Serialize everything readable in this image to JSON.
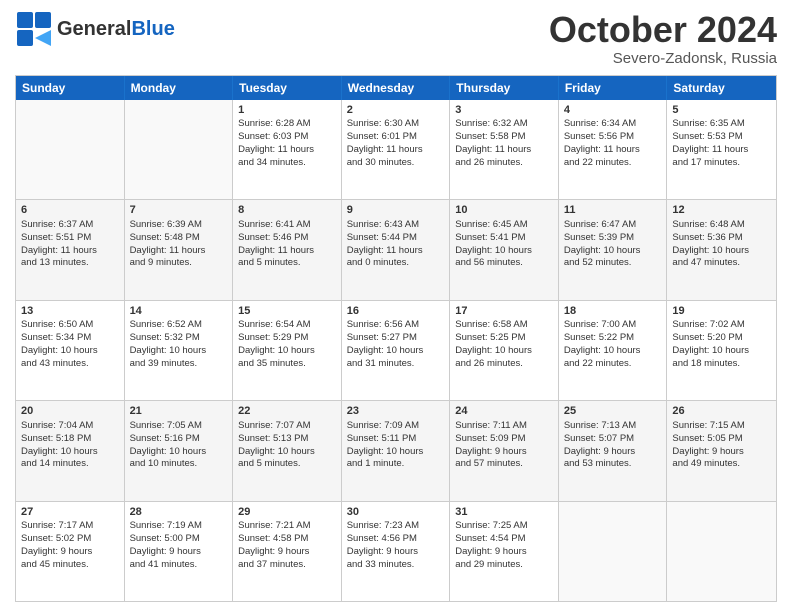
{
  "header": {
    "logo_general": "General",
    "logo_blue": "Blue",
    "month_title": "October 2024",
    "location": "Severo-Zadonsk, Russia"
  },
  "weekdays": [
    "Sunday",
    "Monday",
    "Tuesday",
    "Wednesday",
    "Thursday",
    "Friday",
    "Saturday"
  ],
  "rows": [
    [
      {
        "day": "",
        "lines": []
      },
      {
        "day": "",
        "lines": []
      },
      {
        "day": "1",
        "lines": [
          "Sunrise: 6:28 AM",
          "Sunset: 6:03 PM",
          "Daylight: 11 hours",
          "and 34 minutes."
        ]
      },
      {
        "day": "2",
        "lines": [
          "Sunrise: 6:30 AM",
          "Sunset: 6:01 PM",
          "Daylight: 11 hours",
          "and 30 minutes."
        ]
      },
      {
        "day": "3",
        "lines": [
          "Sunrise: 6:32 AM",
          "Sunset: 5:58 PM",
          "Daylight: 11 hours",
          "and 26 minutes."
        ]
      },
      {
        "day": "4",
        "lines": [
          "Sunrise: 6:34 AM",
          "Sunset: 5:56 PM",
          "Daylight: 11 hours",
          "and 22 minutes."
        ]
      },
      {
        "day": "5",
        "lines": [
          "Sunrise: 6:35 AM",
          "Sunset: 5:53 PM",
          "Daylight: 11 hours",
          "and 17 minutes."
        ]
      }
    ],
    [
      {
        "day": "6",
        "lines": [
          "Sunrise: 6:37 AM",
          "Sunset: 5:51 PM",
          "Daylight: 11 hours",
          "and 13 minutes."
        ]
      },
      {
        "day": "7",
        "lines": [
          "Sunrise: 6:39 AM",
          "Sunset: 5:48 PM",
          "Daylight: 11 hours",
          "and 9 minutes."
        ]
      },
      {
        "day": "8",
        "lines": [
          "Sunrise: 6:41 AM",
          "Sunset: 5:46 PM",
          "Daylight: 11 hours",
          "and 5 minutes."
        ]
      },
      {
        "day": "9",
        "lines": [
          "Sunrise: 6:43 AM",
          "Sunset: 5:44 PM",
          "Daylight: 11 hours",
          "and 0 minutes."
        ]
      },
      {
        "day": "10",
        "lines": [
          "Sunrise: 6:45 AM",
          "Sunset: 5:41 PM",
          "Daylight: 10 hours",
          "and 56 minutes."
        ]
      },
      {
        "day": "11",
        "lines": [
          "Sunrise: 6:47 AM",
          "Sunset: 5:39 PM",
          "Daylight: 10 hours",
          "and 52 minutes."
        ]
      },
      {
        "day": "12",
        "lines": [
          "Sunrise: 6:48 AM",
          "Sunset: 5:36 PM",
          "Daylight: 10 hours",
          "and 47 minutes."
        ]
      }
    ],
    [
      {
        "day": "13",
        "lines": [
          "Sunrise: 6:50 AM",
          "Sunset: 5:34 PM",
          "Daylight: 10 hours",
          "and 43 minutes."
        ]
      },
      {
        "day": "14",
        "lines": [
          "Sunrise: 6:52 AM",
          "Sunset: 5:32 PM",
          "Daylight: 10 hours",
          "and 39 minutes."
        ]
      },
      {
        "day": "15",
        "lines": [
          "Sunrise: 6:54 AM",
          "Sunset: 5:29 PM",
          "Daylight: 10 hours",
          "and 35 minutes."
        ]
      },
      {
        "day": "16",
        "lines": [
          "Sunrise: 6:56 AM",
          "Sunset: 5:27 PM",
          "Daylight: 10 hours",
          "and 31 minutes."
        ]
      },
      {
        "day": "17",
        "lines": [
          "Sunrise: 6:58 AM",
          "Sunset: 5:25 PM",
          "Daylight: 10 hours",
          "and 26 minutes."
        ]
      },
      {
        "day": "18",
        "lines": [
          "Sunrise: 7:00 AM",
          "Sunset: 5:22 PM",
          "Daylight: 10 hours",
          "and 22 minutes."
        ]
      },
      {
        "day": "19",
        "lines": [
          "Sunrise: 7:02 AM",
          "Sunset: 5:20 PM",
          "Daylight: 10 hours",
          "and 18 minutes."
        ]
      }
    ],
    [
      {
        "day": "20",
        "lines": [
          "Sunrise: 7:04 AM",
          "Sunset: 5:18 PM",
          "Daylight: 10 hours",
          "and 14 minutes."
        ]
      },
      {
        "day": "21",
        "lines": [
          "Sunrise: 7:05 AM",
          "Sunset: 5:16 PM",
          "Daylight: 10 hours",
          "and 10 minutes."
        ]
      },
      {
        "day": "22",
        "lines": [
          "Sunrise: 7:07 AM",
          "Sunset: 5:13 PM",
          "Daylight: 10 hours",
          "and 5 minutes."
        ]
      },
      {
        "day": "23",
        "lines": [
          "Sunrise: 7:09 AM",
          "Sunset: 5:11 PM",
          "Daylight: 10 hours",
          "and 1 minute."
        ]
      },
      {
        "day": "24",
        "lines": [
          "Sunrise: 7:11 AM",
          "Sunset: 5:09 PM",
          "Daylight: 9 hours",
          "and 57 minutes."
        ]
      },
      {
        "day": "25",
        "lines": [
          "Sunrise: 7:13 AM",
          "Sunset: 5:07 PM",
          "Daylight: 9 hours",
          "and 53 minutes."
        ]
      },
      {
        "day": "26",
        "lines": [
          "Sunrise: 7:15 AM",
          "Sunset: 5:05 PM",
          "Daylight: 9 hours",
          "and 49 minutes."
        ]
      }
    ],
    [
      {
        "day": "27",
        "lines": [
          "Sunrise: 7:17 AM",
          "Sunset: 5:02 PM",
          "Daylight: 9 hours",
          "and 45 minutes."
        ]
      },
      {
        "day": "28",
        "lines": [
          "Sunrise: 7:19 AM",
          "Sunset: 5:00 PM",
          "Daylight: 9 hours",
          "and 41 minutes."
        ]
      },
      {
        "day": "29",
        "lines": [
          "Sunrise: 7:21 AM",
          "Sunset: 4:58 PM",
          "Daylight: 9 hours",
          "and 37 minutes."
        ]
      },
      {
        "day": "30",
        "lines": [
          "Sunrise: 7:23 AM",
          "Sunset: 4:56 PM",
          "Daylight: 9 hours",
          "and 33 minutes."
        ]
      },
      {
        "day": "31",
        "lines": [
          "Sunrise: 7:25 AM",
          "Sunset: 4:54 PM",
          "Daylight: 9 hours",
          "and 29 minutes."
        ]
      },
      {
        "day": "",
        "lines": []
      },
      {
        "day": "",
        "lines": []
      }
    ]
  ]
}
